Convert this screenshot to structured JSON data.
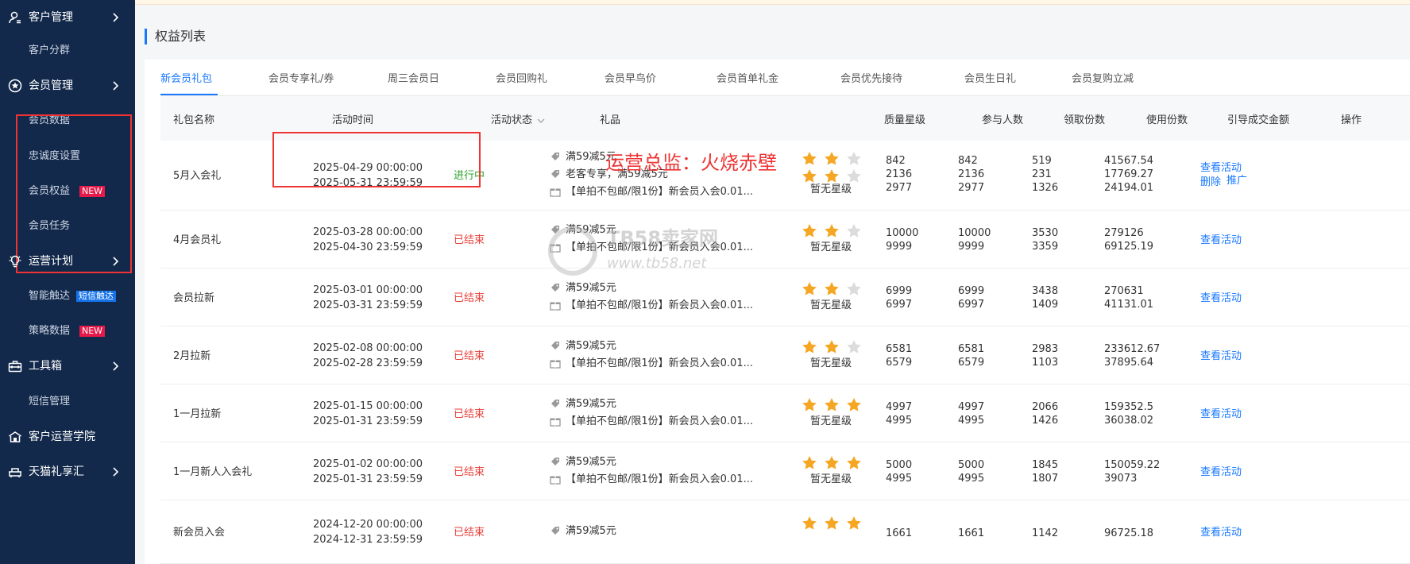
{
  "sidebar": {
    "groups": [
      {
        "label": "客户管理",
        "icon": "user-manage-icon"
      },
      {
        "label": "会员管理",
        "icon": "member-badge-icon"
      },
      {
        "label": "运营计划",
        "icon": "bulb-icon"
      },
      {
        "label": "工具箱",
        "icon": "toolbox-icon"
      },
      {
        "label": "客户运营学院",
        "icon": "academy-icon"
      },
      {
        "label": "天猫礼享汇",
        "icon": "gift-sofa-icon"
      }
    ],
    "subs": {
      "customer_group": "客户分群",
      "member_data": "会员数据",
      "loyalty": "忠诚度设置",
      "member_rights": "会员权益",
      "member_tasks": "会员任务",
      "smart_reach": "智能触达",
      "strategy_data": "策略数据",
      "sms_manage": "短信管理"
    },
    "badges": {
      "new": "NEW",
      "sms_reach": "短信触达"
    }
  },
  "page": {
    "section_title": "权益列表"
  },
  "tabs": [
    "新会员礼包",
    "会员专享礼/券",
    "周三会员日",
    "会员回购礼",
    "会员早鸟价",
    "会员首单礼金",
    "会员优先接待",
    "会员生日礼",
    "会员复购立减"
  ],
  "table": {
    "headers": [
      "礼包名称",
      "活动时间",
      "活动状态",
      "礼品",
      "质量星级",
      "参与人数",
      "领取份数",
      "使用份数",
      "引导成交金额",
      "操作"
    ],
    "star_label": "暂无星级",
    "rows": [
      {
        "name": "5月入会礼",
        "start": "2025-04-29 00:00:00",
        "end": "2025-05-31 23:59:59",
        "status": "进行中",
        "status_type": "live",
        "gifts": [
          {
            "icon": "coupon-tag-icon",
            "text": "满59减5元"
          },
          {
            "icon": "coupon-tag-icon",
            "text": "老客专享，满59减5元"
          },
          {
            "icon": "gift-box-icon",
            "text": "【单拍不包邮/限1份】新会员入会0.01..."
          }
        ],
        "stars": 2,
        "star_rows": 2,
        "participants": [
          "842",
          "2136",
          "2977"
        ],
        "received": [
          "842",
          "2136",
          "2977"
        ],
        "used": [
          "519",
          "231",
          "1326"
        ],
        "amount": [
          "41567.54",
          "17769.27",
          "24194.01"
        ],
        "actions": [
          "查看活动",
          "删除",
          "推广"
        ]
      },
      {
        "name": "4月会员礼",
        "start": "2025-03-28 00:00:00",
        "end": "2025-04-30 23:59:59",
        "status": "已结束",
        "status_type": "end",
        "gifts": [
          {
            "icon": "coupon-tag-icon",
            "text": "满59减5元"
          },
          {
            "icon": "gift-box-icon",
            "text": "【单拍不包邮/限1份】新会员入会0.01..."
          }
        ],
        "stars": 2,
        "star_rows": 1,
        "participants": [
          "10000",
          "9999"
        ],
        "received": [
          "10000",
          "9999"
        ],
        "used": [
          "3530",
          "3359"
        ],
        "amount": [
          "279126",
          "69125.19"
        ],
        "actions": [
          "查看活动"
        ]
      },
      {
        "name": "会员拉新",
        "start": "2025-03-01 00:00:00",
        "end": "2025-03-31 23:59:59",
        "status": "已结束",
        "status_type": "end",
        "gifts": [
          {
            "icon": "coupon-tag-icon",
            "text": "满59减5元"
          },
          {
            "icon": "gift-box-icon",
            "text": "【单拍不包邮/限1份】新会员入会0.01..."
          }
        ],
        "stars": 2,
        "star_rows": 1,
        "participants": [
          "6999",
          "6997"
        ],
        "received": [
          "6999",
          "6997"
        ],
        "used": [
          "3438",
          "1409"
        ],
        "amount": [
          "270631",
          "41131.01"
        ],
        "actions": [
          "查看活动"
        ]
      },
      {
        "name": "2月拉新",
        "start": "2025-02-08 00:00:00",
        "end": "2025-02-28 23:59:59",
        "status": "已结束",
        "status_type": "end",
        "gifts": [
          {
            "icon": "coupon-tag-icon",
            "text": "满59减5元"
          },
          {
            "icon": "gift-box-icon",
            "text": "【单拍不包邮/限1份】新会员入会0.01..."
          }
        ],
        "stars": 2,
        "star_rows": 1,
        "participants": [
          "6581",
          "6579"
        ],
        "received": [
          "6581",
          "6579"
        ],
        "used": [
          "2983",
          "1103"
        ],
        "amount": [
          "233612.67",
          "37895.64"
        ],
        "actions": [
          "查看活动"
        ]
      },
      {
        "name": "1一月拉新",
        "start": "2025-01-15 00:00:00",
        "end": "2025-01-31 23:59:59",
        "status": "已结束",
        "status_type": "end",
        "gifts": [
          {
            "icon": "coupon-tag-icon",
            "text": "满59减5元"
          },
          {
            "icon": "gift-box-icon",
            "text": "【单拍不包邮/限1份】新会员入会0.01..."
          }
        ],
        "stars": 3,
        "star_rows": 1,
        "participants": [
          "4997",
          "4995"
        ],
        "received": [
          "4997",
          "4995"
        ],
        "used": [
          "2066",
          "1426"
        ],
        "amount": [
          "159352.5",
          "36038.02"
        ],
        "actions": [
          "查看活动"
        ]
      },
      {
        "name": "1一月新人入会礼",
        "start": "2025-01-02 00:00:00",
        "end": "2025-01-31 23:59:59",
        "status": "已结束",
        "status_type": "end",
        "gifts": [
          {
            "icon": "coupon-tag-icon",
            "text": "满59减5元"
          },
          {
            "icon": "gift-box-icon",
            "text": "【单拍不包邮/限1份】新会员入会0.01..."
          }
        ],
        "stars": 3,
        "star_rows": 1,
        "participants": [
          "5000",
          "4995"
        ],
        "received": [
          "5000",
          "4995"
        ],
        "used": [
          "1845",
          "1807"
        ],
        "amount": [
          "150059.22",
          "39073"
        ],
        "actions": [
          "查看活动"
        ]
      },
      {
        "name": "新会员入会",
        "start": "2024-12-20 00:00:00",
        "end": "2024-12-31 23:59:59",
        "status": "已结束",
        "status_type": "end",
        "gifts": [
          {
            "icon": "coupon-tag-icon",
            "text": "满59减5元"
          }
        ],
        "stars": 3,
        "star_rows": 1,
        "participants": [
          "1661"
        ],
        "received": [
          "1661"
        ],
        "used": [
          "1142"
        ],
        "amount": [
          "96725.18"
        ],
        "actions": [
          "查看活动"
        ]
      }
    ]
  },
  "overlay": {
    "caption": "运营总监：火烧赤壁"
  },
  "watermark": {
    "name": "TB58卖家网",
    "url": "www.tb58.net"
  },
  "colors": {
    "sidebar": "#13294b",
    "accent": "#1677ff",
    "live": "#2aa12a",
    "ended": "#e8413b",
    "star": "#f5a623",
    "highlight": "#e33"
  }
}
